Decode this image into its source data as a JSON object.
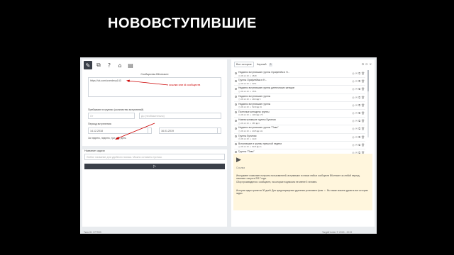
{
  "slide_title": "НОВОВСТУПИВШИЕ",
  "toolbar": {
    "icons": [
      "edit-icon",
      "share-icon",
      "help-icon",
      "home-icon",
      "list-icon"
    ],
    "glyphs": [
      "✎",
      "⧉",
      "?",
      "⌂",
      "▤"
    ]
  },
  "form": {
    "communities_label": "Сообщества ВКонтакте",
    "communities_value": "https://vk.com/overdevy143",
    "annotation_text": "ссылки или id сообществ",
    "members_label": "Пребывают в группах (количество вступлений)",
    "members_from_placeholder": "От",
    "members_to_placeholder": "До (необязательно)",
    "period_label": "Период вступления",
    "date_from": "14.12.2018",
    "date_to": "16.01.2019",
    "date_hint": "За неделю, неделю, три дня, день",
    "task_label": "Название задачи",
    "task_placeholder": "Любое название для удобного поиска. Можно оставить пустым.",
    "run_icon": "play-icon",
    "run_glyph": "▷",
    "version": "Ткач ID: 377993"
  },
  "results": {
    "tab_all": "Все историе",
    "tab_drafts": "Черный",
    "tab_drafts_count": "0",
    "items": [
      {
        "name": "Недавно вступившие группы Орифлейм в Н...",
        "meta": "◷ 28.12.18  ☺ 4848"
      },
      {
        "name": "Группы Орифлейма в Н...",
        "meta": "◷ 28.12.18  ☺ 6251"
      },
      {
        "name": "Недавно вступившие группы диетических женщин",
        "meta": "◷ 28.12.18  ☺ 1531"
      },
      {
        "name": "Недавно вступившие группы",
        "meta": "◷ 28.12.18  ☺ 2484  ◉ 5"
      },
      {
        "name": "Недавно вступившие группы",
        "meta": "◷ 28.12.18  ☺ 5249  ◉ 19"
      },
      {
        "name": "Полезные женщины группы",
        "meta": "◷ 28.12.18  ☺ 1384  ◉ 176"
      },
      {
        "name": "Новевступившие группы Буниная",
        "meta": "◷ 28.12.18  ☺ 385  ◉ 3"
      },
      {
        "name": "Недавно вступившие группы \"Пиво\"",
        "meta": "◷ 28.12.18  ☺ 2025  ◉ 141"
      },
      {
        "name": "Группы Буниная",
        "meta": "◷ 28.12.18  ☺ 1120"
      },
      {
        "name": "Вступившие в группы прешлой недели",
        "meta": "◷ 28.12.18  ☺ 8115  ◉ 21"
      },
      {
        "name": "Группы \"Пиво\"",
        "meta": "◷ 28.12.18  ☺ 1522  ◉ 46"
      }
    ],
    "item_actions": "◎ ✉ ⧉ 🗑"
  },
  "info": {
    "icon": "video-icon",
    "icon_glyph": "▶",
    "icon_caption": "Ссылка",
    "p1": "Инструмент позволяет получить пользователей, вступивших в списки любых сообществ ВКонтакте за любой период, начиная с августа 2017 года.",
    "p2": "Сбор производится с сообществ, на которые подписано не менее 5 человек.",
    "p3": "История задач хранится 30 дней. Для предотвращения удаления установите флаг ☆. Вы также можете удалить все историю задач.",
    "footer": "TargetHunter © 2015 - 2019"
  }
}
